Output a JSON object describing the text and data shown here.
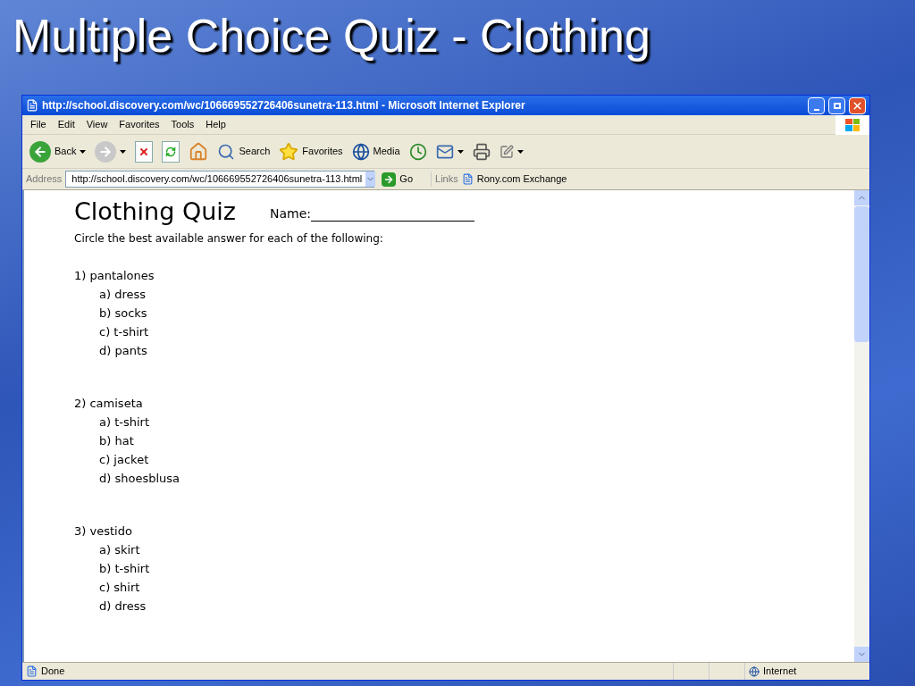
{
  "slide_title": "Multiple Choice Quiz - Clothing",
  "window": {
    "title": "http://school.discovery.com/wc/106669552726406sunetra-113.html - Microsoft Internet Explorer"
  },
  "menu": [
    "File",
    "Edit",
    "View",
    "Favorites",
    "Tools",
    "Help"
  ],
  "toolbar": [
    {
      "kind": "back",
      "label": "Back"
    },
    {
      "kind": "forward"
    },
    {
      "kind": "stop"
    },
    {
      "kind": "refresh"
    },
    {
      "kind": "home"
    },
    {
      "kind": "search",
      "label": "Search"
    },
    {
      "kind": "favorites",
      "label": "Favorites"
    },
    {
      "kind": "media",
      "label": "Media"
    },
    {
      "kind": "history"
    },
    {
      "kind": "mail"
    },
    {
      "kind": "print"
    },
    {
      "kind": "edit"
    }
  ],
  "address_bar": {
    "label": "Address",
    "url": "http://school.discovery.com/wc/106669552726406sunetra-113.html",
    "go": "Go",
    "links_label": "Links",
    "link": "Rony.com Exchange"
  },
  "page": {
    "heading": "Clothing Quiz",
    "name_label": "Name:",
    "instruction": "Circle the best available answer for each of the following:",
    "questions": [
      {
        "text": "1) pantalones",
        "options": [
          "a) dress",
          "b) socks",
          "c) t-shirt",
          "d) pants"
        ]
      },
      {
        "text": "2) camiseta",
        "options": [
          "a) t-shirt",
          "b) hat",
          "c) jacket",
          "d) shoesblusa"
        ]
      },
      {
        "text": "3) vestido",
        "options": [
          "a) skirt",
          "b) t-shirt",
          "c) shirt",
          "d) dress"
        ]
      }
    ]
  },
  "status_bar": {
    "text": "Done",
    "zone": "Internet"
  }
}
